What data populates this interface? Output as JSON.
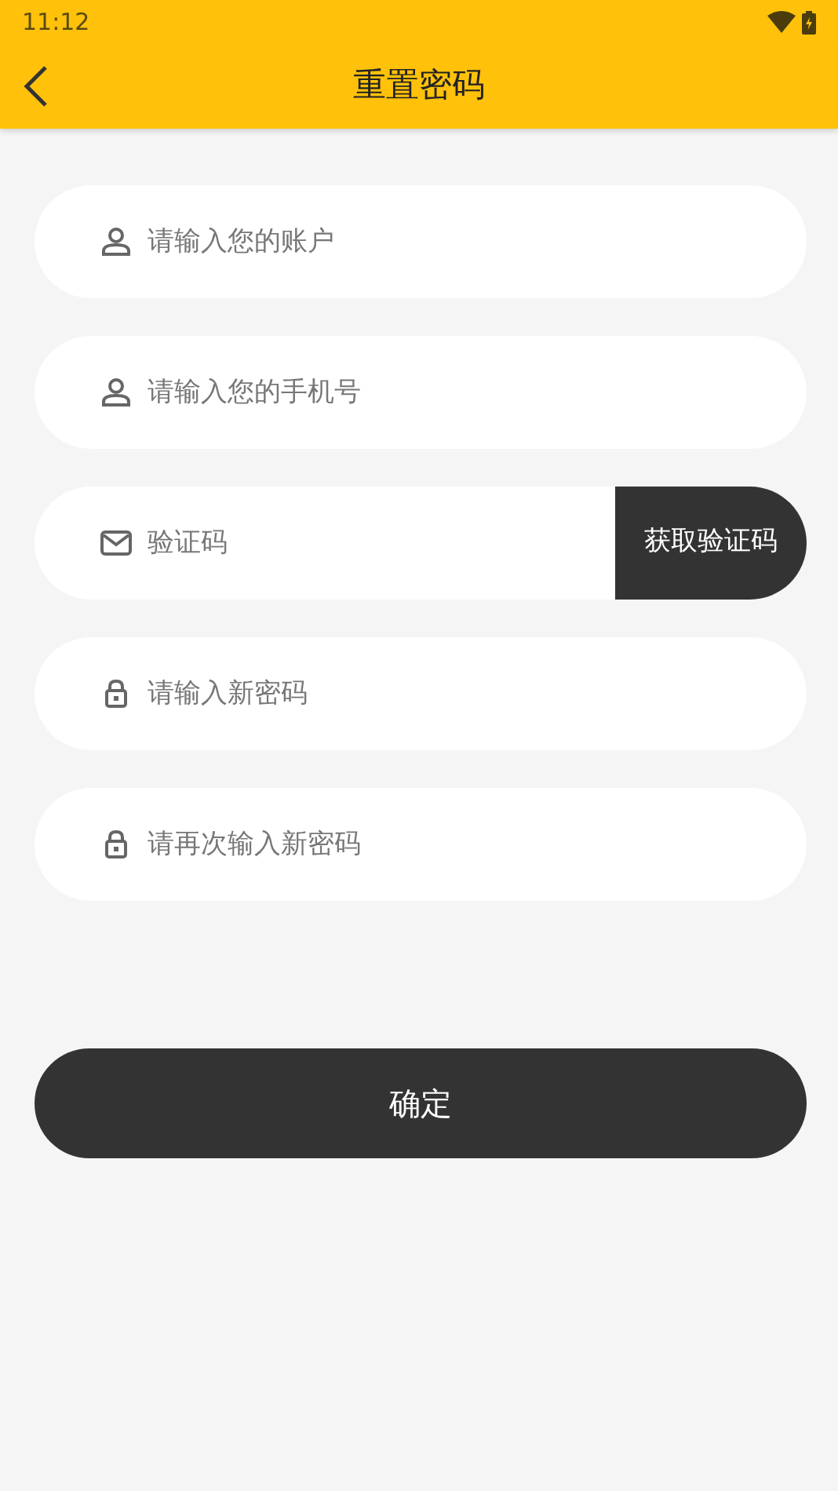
{
  "status_bar": {
    "time": "11:12"
  },
  "app_bar": {
    "title": "重置密码"
  },
  "fields": [
    {
      "kind": "account",
      "placeholder": "请输入您的账户"
    },
    {
      "kind": "account",
      "placeholder": "请输入您的手机号"
    },
    {
      "kind": "code",
      "placeholder": "验证码",
      "button": "获取验证码"
    },
    {
      "kind": "password",
      "placeholder": "请输入新密码"
    },
    {
      "kind": "password",
      "placeholder": "请再次输入新密码"
    }
  ],
  "submit": "确定"
}
